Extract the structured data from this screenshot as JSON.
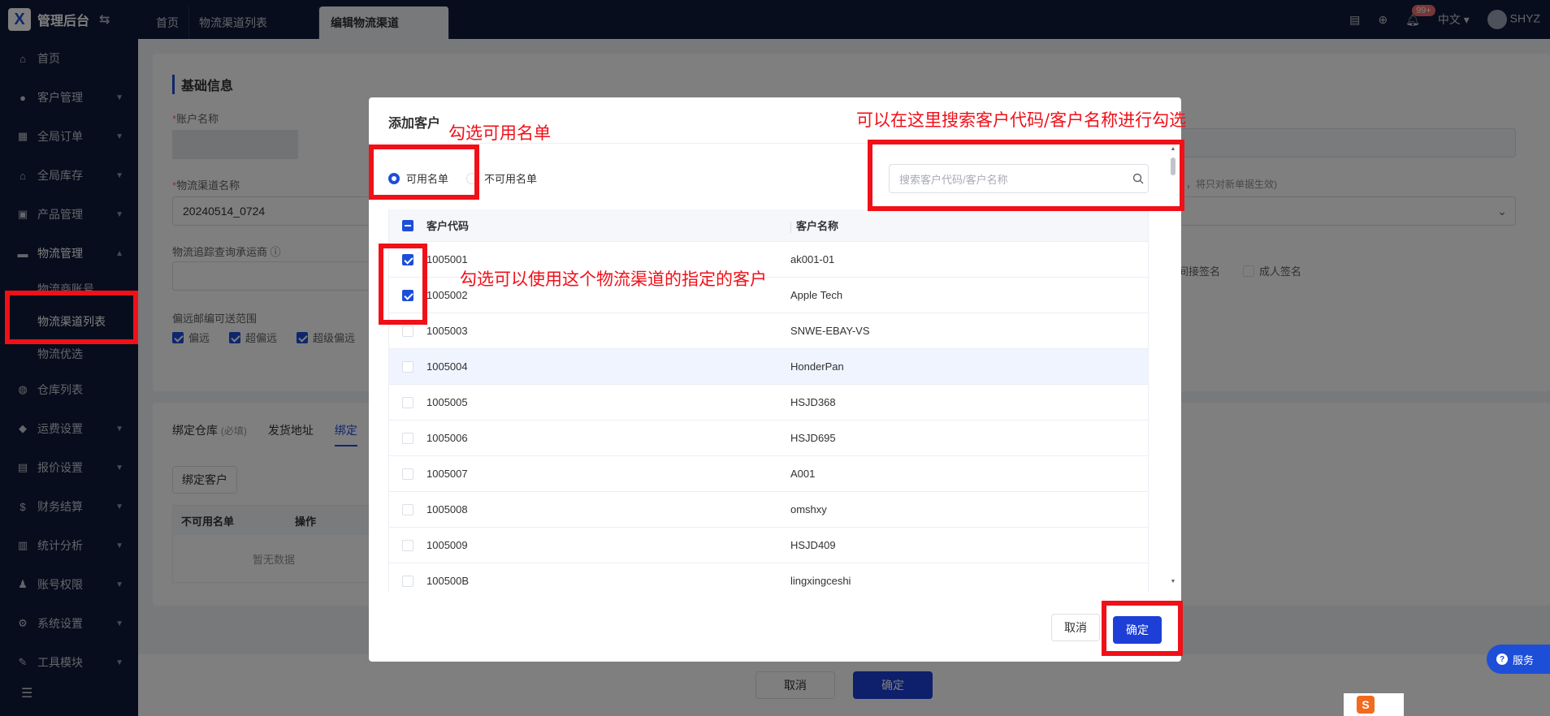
{
  "app": {
    "title": "管理后台",
    "logo_letter": "X"
  },
  "tabs": [
    "首页",
    "物流渠道列表",
    "编辑物流渠道"
  ],
  "topbar": {
    "notif_count": "99+",
    "language": "中文",
    "user": "SHYZ"
  },
  "sidebar": {
    "items": [
      {
        "label": "首页",
        "icon": "home-icon"
      },
      {
        "label": "客户管理",
        "icon": "users-icon"
      },
      {
        "label": "全局订单",
        "icon": "order-icon"
      },
      {
        "label": "全局库存",
        "icon": "stock-icon"
      },
      {
        "label": "产品管理",
        "icon": "product-icon"
      },
      {
        "label": "物流管理",
        "icon": "truck-icon"
      },
      {
        "label": "仓库列表",
        "icon": "warehouse-icon"
      },
      {
        "label": "运费设置",
        "icon": "freight-icon"
      },
      {
        "label": "报价设置",
        "icon": "quote-icon"
      },
      {
        "label": "财务结算",
        "icon": "finance-icon"
      },
      {
        "label": "统计分析",
        "icon": "stats-icon"
      },
      {
        "label": "账号权限",
        "icon": "account-icon"
      },
      {
        "label": "系统设置",
        "icon": "settings-icon"
      },
      {
        "label": "工具模块",
        "icon": "tool-icon"
      }
    ],
    "subitems": [
      "物流商账号",
      "物流渠道列表",
      "物流优选"
    ]
  },
  "page": {
    "section_title": "基础信息",
    "account_label": "账户名称",
    "channel_name_label": "物流渠道名称",
    "channel_name_value": "20240514_0724",
    "tracking_label": "物流追踪查询承运商",
    "remote_label": "偏远邮编可送范围",
    "remote_options": [
      "偏远",
      "超偏远",
      "超级偏远"
    ],
    "right_hint": "，将只对新单据生效)",
    "signature_options": [
      "间接签名",
      "成人签名"
    ],
    "subtabs": [
      "绑定仓库",
      "发货地址",
      "绑定"
    ],
    "subtab_hint": "(必填)",
    "bind_customer_button": "绑定客户",
    "table_headers": [
      "不可用名单",
      "操作"
    ],
    "empty_text": "暂无数据",
    "cancel": "取消",
    "confirm": "确定"
  },
  "modal": {
    "title": "添加客户",
    "radio_available": "可用名单",
    "radio_unavailable": "不可用名单",
    "search_placeholder": "搜索客户代码/客户名称",
    "col_code": "客户代码",
    "col_name": "客户名称",
    "rows": [
      {
        "code": "1005001",
        "name": "ak001-01",
        "checked": true
      },
      {
        "code": "1005002",
        "name": "Apple Tech",
        "checked": true
      },
      {
        "code": "1005003",
        "name": "SNWE-EBAY-VS",
        "checked": false
      },
      {
        "code": "1005004",
        "name": "HonderPan",
        "checked": false
      },
      {
        "code": "1005005",
        "name": "HSJD368",
        "checked": false
      },
      {
        "code": "1005006",
        "name": "HSJD695",
        "checked": false
      },
      {
        "code": "1005007",
        "name": "A001",
        "checked": false
      },
      {
        "code": "1005008",
        "name": "omshxy",
        "checked": false
      },
      {
        "code": "1005009",
        "name": "HSJD409",
        "checked": false
      },
      {
        "code": "100500B",
        "name": "lingxingceshi",
        "checked": false
      }
    ],
    "cancel": "取消",
    "confirm": "确定"
  },
  "annotations": {
    "select_available": "勾选可用名单",
    "search_hint": "可以在这里搜索客户代码/客户名称进行勾选",
    "customer_hint": "勾选可以使用这个物流渠道的指定的客户"
  },
  "help": "服务",
  "colors": {
    "primary": "#1d3fd8",
    "annotation": "#f01018",
    "nav_bg": "#0e1a38"
  }
}
